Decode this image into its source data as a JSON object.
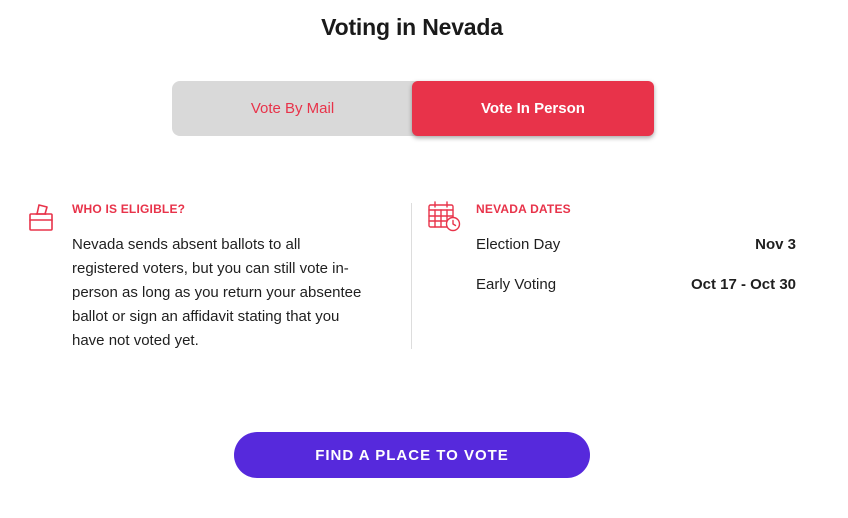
{
  "page_title": "Voting in Nevada",
  "tabs": [
    {
      "label": "Vote By Mail",
      "active": false
    },
    {
      "label": "Vote In Person",
      "active": true
    }
  ],
  "eligibility": {
    "heading": "WHO IS ELIGIBLE?",
    "icon": "ballot-box-icon",
    "body": "Nevada sends absent ballots to all registered voters, but you can still vote in-person as long as you return your absentee ballot or sign an affidavit stating that you have not voted yet."
  },
  "dates": {
    "heading": "NEVADA DATES",
    "icon": "calendar-clock-icon",
    "rows": [
      {
        "label": "Election Day",
        "value": "Nov 3"
      },
      {
        "label": "Early Voting",
        "value": "Oct 17 - Oct 30"
      }
    ]
  },
  "cta": {
    "label": "FIND A PLACE TO VOTE"
  },
  "colors": {
    "accent": "#e8334a",
    "cta": "#5629dc",
    "toggle_bg": "#d9d9d9"
  }
}
